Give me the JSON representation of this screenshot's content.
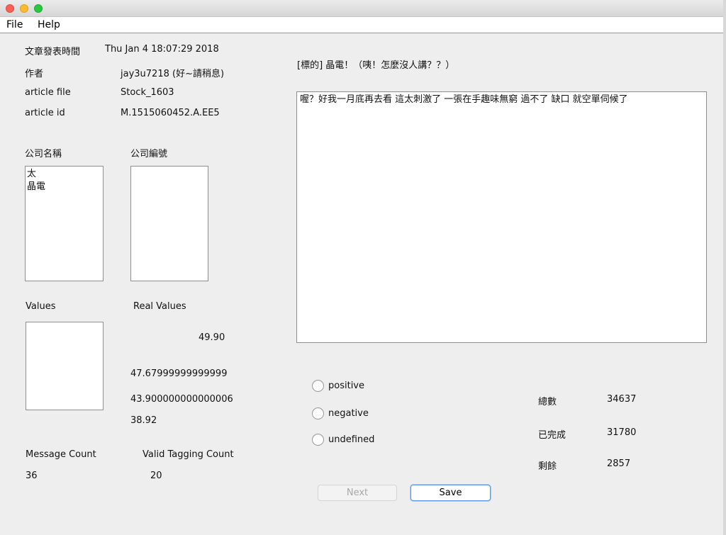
{
  "menu": {
    "file": "File",
    "help": "Help"
  },
  "article": {
    "post_time_label": "文章發表時間",
    "post_time_value": "Thu Jan  4 18:07:29 2018",
    "author_label": "作者",
    "author_value": "jay3u7218 (好~請稍息)",
    "file_label": "article file",
    "file_value": "Stock_1603",
    "id_label": "article id",
    "id_value": "M.1515060452.A.EE5",
    "title": "[標的] 晶電！（咦！怎麼沒人講？？）",
    "body": "喔？好我一月底再去看 這太刺激了 一張在手趣味無窮 過不了 缺口 就空單伺候了"
  },
  "company": {
    "name_label": "公司名稱",
    "code_label": "公司編號",
    "names": [
      "太",
      "晶電"
    ],
    "codes": []
  },
  "values": {
    "values_label": "Values",
    "real_values_label": "Real Values",
    "items": [],
    "real_values": [
      "49.90",
      "47.67999999999999",
      "43.900000000000006",
      "38.92"
    ]
  },
  "counts": {
    "message_label": "Message Count",
    "message_value": "36",
    "valid_label": "Valid Tagging Count",
    "valid_value": "20"
  },
  "sentiment": {
    "options": [
      "positive",
      "negative",
      "undefined"
    ]
  },
  "stats": {
    "total_label": "總數",
    "total_value": "34637",
    "done_label": "已完成",
    "done_value": "31780",
    "remaining_label": "剩餘",
    "remaining_value": "2857"
  },
  "buttons": {
    "next": "Next",
    "save": "Save"
  }
}
